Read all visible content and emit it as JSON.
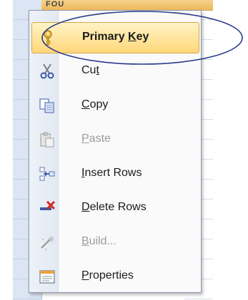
{
  "header": {
    "column_title": "FOU"
  },
  "context_menu": {
    "items": [
      {
        "label": "Primary Key",
        "mnemonic_pre": "Primary ",
        "mnemonic": "K",
        "mnemonic_post": "ey",
        "icon": "key-icon",
        "enabled": true,
        "selected": true
      },
      {
        "label": "Cut",
        "mnemonic_pre": "Cu",
        "mnemonic": "t",
        "mnemonic_post": "",
        "icon": "scissors-icon",
        "enabled": true,
        "selected": false
      },
      {
        "label": "Copy",
        "mnemonic_pre": "",
        "mnemonic": "C",
        "mnemonic_post": "opy",
        "icon": "copy-icon",
        "enabled": true,
        "selected": false
      },
      {
        "label": "Paste",
        "mnemonic_pre": "",
        "mnemonic": "P",
        "mnemonic_post": "aste",
        "icon": "paste-icon",
        "enabled": false,
        "selected": false
      },
      {
        "label": "Insert Rows",
        "mnemonic_pre": "",
        "mnemonic": "I",
        "mnemonic_post": "nsert Rows",
        "icon": "insert-rows-icon",
        "enabled": true,
        "selected": false
      },
      {
        "label": "Delete Rows",
        "mnemonic_pre": "",
        "mnemonic": "D",
        "mnemonic_post": "elete Rows",
        "icon": "delete-rows-icon",
        "enabled": true,
        "selected": false
      },
      {
        "label": "Build...",
        "mnemonic_pre": "",
        "mnemonic": "B",
        "mnemonic_post": "uild...",
        "icon": "build-wand-icon",
        "enabled": false,
        "selected": false
      },
      {
        "label": "Properties",
        "mnemonic_pre": "",
        "mnemonic": "P",
        "mnemonic_post": "roperties",
        "icon": "properties-icon",
        "enabled": true,
        "selected": false
      }
    ]
  },
  "colors": {
    "highlight_fill": "#ffd77a",
    "annotation_stroke": "#2a3a8c"
  }
}
